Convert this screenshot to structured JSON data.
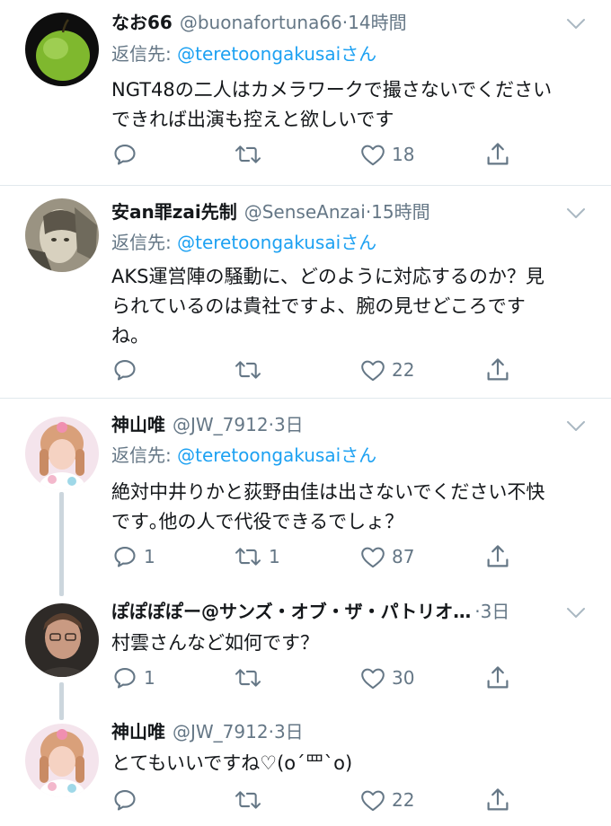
{
  "tweets": [
    {
      "name": "なお66",
      "handle": "@buonafortuna66",
      "time": "14時間",
      "reply_prefix": "返信先: ",
      "reply_to": "@teretoongakusaiさん",
      "text": "NGT48の二人はカメラワークで撮さないでください\nできれば出演も控えと欲しいです",
      "reply_count": "",
      "retweet_count": "",
      "like_count": "18"
    },
    {
      "name": "安an罪zai先制",
      "handle": "@SenseAnzai",
      "time": "15時間",
      "reply_prefix": "返信先: ",
      "reply_to": "@teretoongakusaiさん",
      "text": "AKS運営陣の騒動に、どのように対応するのか？見\nられているのは貴社ですよ、腕の見せどころです\nね。",
      "reply_count": "",
      "retweet_count": "",
      "like_count": "22"
    },
    {
      "name": "神山唯",
      "handle": "@JW_7912",
      "time": "3日",
      "reply_prefix": "返信先: ",
      "reply_to": "@teretoongakusaiさん",
      "text": "絶対中井りかと荻野由佳は出さないでください不快\nです｡他の人で代役できるでしょ？",
      "reply_count": "1",
      "retweet_count": "1",
      "like_count": "87"
    },
    {
      "name": "ぽぽぽぽー@サンズ・オブ・ザ・パトリオ…",
      "handle": "",
      "time": "3日",
      "text": "村雲さんなど如何です？",
      "reply_count": "1",
      "retweet_count": "",
      "like_count": "30"
    },
    {
      "name": "神山唯",
      "handle": "@JW_7912",
      "time": "3日",
      "text": "とてもいいですね♡(o´罒`o)",
      "reply_count": "",
      "retweet_count": "",
      "like_count": "22"
    }
  ],
  "separator": "·",
  "icons": [
    "chevron-down-icon",
    "reply-icon",
    "retweet-icon",
    "like-icon",
    "share-icon"
  ],
  "colors": {
    "link": "#1da1f2",
    "muted": "#657786",
    "text": "#14171a",
    "divider": "#e1e8ed",
    "thread": "#ccd6dd"
  }
}
